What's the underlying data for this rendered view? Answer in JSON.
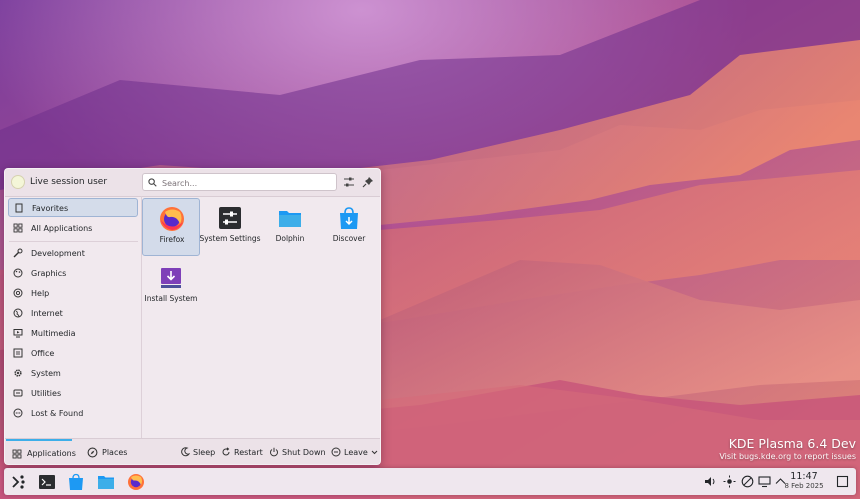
{
  "watermark": {
    "title": "KDE Plasma 6.4 Dev",
    "subtitle": "Visit bugs.kde.org to report issues"
  },
  "launcher": {
    "user_name": "Live session user",
    "search": {
      "placeholder": "Search..."
    },
    "sidebar": {
      "items": [
        {
          "label": "Favorites",
          "icon": "bookmark-icon"
        },
        {
          "label": "All Applications",
          "icon": "grid-icon"
        },
        {
          "label": "Development",
          "icon": "wrench-icon"
        },
        {
          "label": "Graphics",
          "icon": "palette-icon"
        },
        {
          "label": "Help",
          "icon": "help-icon"
        },
        {
          "label": "Internet",
          "icon": "globe-icon"
        },
        {
          "label": "Multimedia",
          "icon": "monitor-play-icon"
        },
        {
          "label": "Office",
          "icon": "office-icon"
        },
        {
          "label": "System",
          "icon": "gear-icon"
        },
        {
          "label": "Utilities",
          "icon": "utilities-icon"
        },
        {
          "label": "Lost & Found",
          "icon": "dots-circle-icon"
        }
      ]
    },
    "apps": [
      {
        "label": "Firefox",
        "icon": "firefox-icon"
      },
      {
        "label": "System Settings",
        "icon": "settings-icon"
      },
      {
        "label": "Dolphin",
        "icon": "folder-icon"
      },
      {
        "label": "Discover",
        "icon": "discover-bag-icon"
      },
      {
        "label": "Install System",
        "icon": "install-icon"
      }
    ],
    "footer": {
      "tabs": [
        {
          "label": "Applications",
          "icon": "grid-icon"
        },
        {
          "label": "Places",
          "icon": "compass-icon"
        }
      ],
      "power": {
        "sleep": "Sleep",
        "restart": "Restart",
        "shutdown": "Shut Down",
        "leave": "Leave"
      }
    }
  },
  "taskbar": {
    "clock": {
      "time": "11:47",
      "date": "8 Feb 2025"
    },
    "launchers": [
      "app-launcher-icon",
      "terminal-icon",
      "discover-icon",
      "folder-icon",
      "firefox-icon"
    ],
    "tray": [
      "volume-icon",
      "brightness-icon",
      "network-icon",
      "display-icon",
      "chevron-up-icon"
    ]
  }
}
